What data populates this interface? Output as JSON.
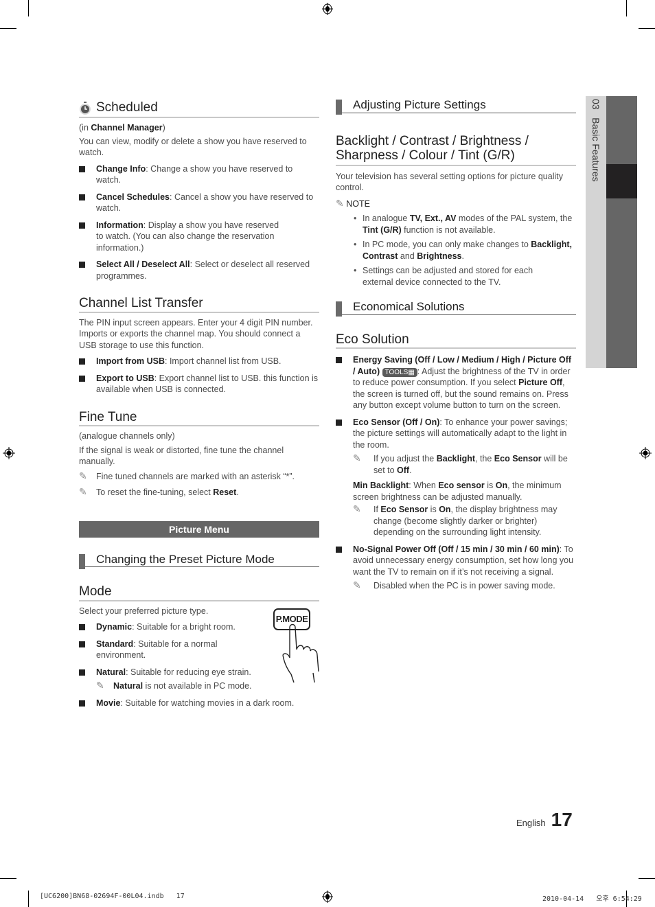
{
  "left": {
    "scheduled": {
      "title": "Scheduled",
      "context_pre": "(in ",
      "context_bold": "Channel Manager",
      "context_post": ")",
      "intro": "You can view, modify or delete a show you have reserved to watch.",
      "items": [
        {
          "term": "Change Info",
          "desc": ": Change a show you have reserved to watch."
        },
        {
          "term": "Cancel Schedules",
          "desc": ": Cancel a show you have reserved to watch."
        },
        {
          "term": "Information",
          "desc": ": Display a show you have reserved to watch. (You can also change the reservation information.)"
        },
        {
          "term": "Select All / Deselect All",
          "desc": ": Select or deselect all reserved programmes."
        }
      ]
    },
    "channel_list_transfer": {
      "title": "Channel List Transfer",
      "intro": "The PIN input screen appears. Enter your 4 digit PIN number. Imports or exports the channel map. You should connect a USB storage to use this function.",
      "items": [
        {
          "term": "Import from USB",
          "desc": ": Import channel list from USB."
        },
        {
          "term": "Export to USB",
          "desc": ": Export channel list to USB. this function is available when USB is connected."
        }
      ]
    },
    "fine_tune": {
      "title": "Fine Tune",
      "context": "(analogue channels only)",
      "intro": "If the signal is weak or distorted, fine tune the channel manually.",
      "note1": "Fine tuned channels are marked with an asterisk “*”.",
      "note2_pre": "To reset the fine-tuning, select ",
      "note2_bold": "Reset",
      "note2_post": "."
    },
    "banner": "Picture Menu",
    "subsection": "Changing the Preset Picture Mode",
    "mode": {
      "title": "Mode",
      "intro": "Select your preferred picture type.",
      "button_label": "P.MODE",
      "items": [
        {
          "term": "Dynamic",
          "desc": ": Suitable for a bright room."
        },
        {
          "term": "Standard",
          "desc": ": Suitable for a normal environment."
        },
        {
          "term": "Natural",
          "desc": ": Suitable for reducing eye strain."
        },
        {
          "term": "Movie",
          "desc": ": Suitable for watching movies in a dark room."
        }
      ],
      "natural_note_bold": "Natural",
      "natural_note_rest": " is not available in PC mode."
    }
  },
  "right": {
    "subsection1": "Adjusting Picture Settings",
    "backlight": {
      "title": "Backlight / Contrast / Brightness / Sharpness / Colour / Tint (G/R)",
      "intro": "Your television has several setting options for picture quality control.",
      "note_label": "NOTE",
      "notes": [
        {
          "a": "In analogue ",
          "b": "TV, Ext., AV",
          "c": " modes of the PAL system, the ",
          "d": "Tint (G/R)",
          "e": " function is not available."
        },
        {
          "a": "In PC mode, you can only make changes to ",
          "b": "Backlight, Contrast",
          "c": " and ",
          "d": "Brightness",
          "e": "."
        },
        {
          "a": "Settings can be adjusted and stored for each external device connected to the TV.",
          "b": "",
          "c": "",
          "d": "",
          "e": ""
        }
      ]
    },
    "subsection2": "Economical Solutions",
    "eco": {
      "title": "Eco Solution",
      "energy_term": "Energy Saving (Off / Low / Medium / High / Picture Off / Auto)",
      "tools_label": "TOOLS",
      "energy_desc1": ": Adjust the brightness of the TV in order to reduce power consumption. If you select ",
      "energy_bold": "Picture Off",
      "energy_desc2": ", the screen is turned off, but the sound remains on. Press any button except volume button to turn on the screen.",
      "sensor_term": "Eco Sensor (Off / On)",
      "sensor_desc": ": To enhance your power savings; the picture settings will automatically adapt to the light in the room.",
      "sensor_note": {
        "a": "If you adjust the ",
        "b": "Backlight",
        "c": ", the ",
        "d": "Eco Sensor",
        "e": " will be set to ",
        "f": "Off",
        "g": "."
      },
      "min_backlight": {
        "a": "Min Backlight",
        "b": ": When ",
        "c": "Eco sensor",
        "d": " is ",
        "e": "On",
        "f": ", the minimum screen brightness can be adjusted manually."
      },
      "min_note": {
        "a": "If ",
        "b": "Eco Sensor",
        "c": " is ",
        "d": "On",
        "e": ", the display brightness may change (become slightly darker or brighter) depending on the surrounding light intensity."
      },
      "nosignal_term": "No-Signal Power Off (Off / 15 min / 30 min / 60 min)",
      "nosignal_desc": ": To avoid unnecessary energy consumption, set how long you want the TV to remain on if it’s not receiving a signal.",
      "nosignal_note": "Disabled when the PC is in power saving mode."
    }
  },
  "side_tab": {
    "chapter": "03",
    "label": "Basic Features"
  },
  "footer": {
    "language": "English",
    "page_number": "17",
    "file_info": "[UC6200]BN68-02694F-00L04.indb   17",
    "timestamp": "2010-04-14   오후 6:54:29"
  }
}
